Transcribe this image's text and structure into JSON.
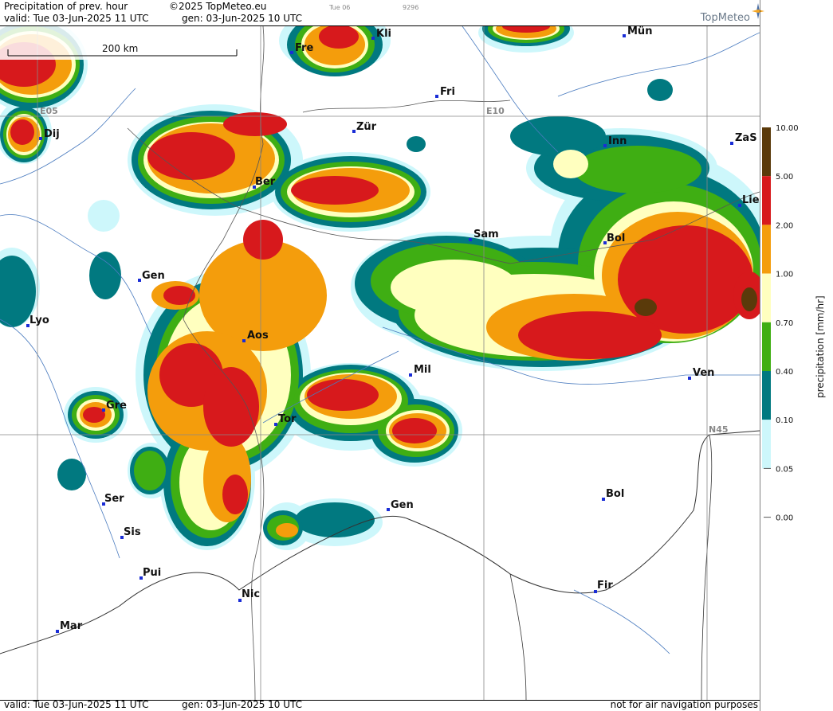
{
  "header": {
    "title": "Precipitation of prev. hour",
    "copyright": "©2025 TopMeteo.eu",
    "small_date": "Tue 06",
    "small_code": "9296",
    "valid": "valid:  Tue  03-Jun-2025  11 UTC",
    "gen": "gen:  03-Jun-2025 10 UTC",
    "logo": "TopMeteo"
  },
  "footer": {
    "valid": "valid:  Tue  03-Jun-2025  11 UTC",
    "gen": "gen: 03-Jun-2025 10 UTC",
    "disclaimer": "not for air navigation purposes"
  },
  "map": {
    "scale_label": "200 km",
    "grid_labels": [
      "E05",
      "E10",
      "N45"
    ],
    "cities": [
      {
        "name": "Kli"
      },
      {
        "name": "Mün"
      },
      {
        "name": "Fre"
      },
      {
        "name": "Fri"
      },
      {
        "name": "Dij"
      },
      {
        "name": "Zür"
      },
      {
        "name": "Inn"
      },
      {
        "name": "ZaS"
      },
      {
        "name": "Ber"
      },
      {
        "name": "Lie"
      },
      {
        "name": "Sam"
      },
      {
        "name": "Bol"
      },
      {
        "name": "Gen"
      },
      {
        "name": "Lyo"
      },
      {
        "name": "Aos"
      },
      {
        "name": "Mil"
      },
      {
        "name": "Ven"
      },
      {
        "name": "Gre"
      },
      {
        "name": "Tor"
      },
      {
        "name": "Ser"
      },
      {
        "name": "Gen"
      },
      {
        "name": "Bol"
      },
      {
        "name": "Sis"
      },
      {
        "name": "Pui"
      },
      {
        "name": "Nic"
      },
      {
        "name": "Fir"
      },
      {
        "name": "Mar"
      }
    ]
  },
  "legend": {
    "title": "precipitation [mm/hr]",
    "levels": [
      {
        "label": "10.00",
        "color": "#5a3a0a"
      },
      {
        "label": "5.00",
        "color": "#d7191c"
      },
      {
        "label": "2.00",
        "color": "#f49d0c"
      },
      {
        "label": "1.00",
        "color": "#ffffbf"
      },
      {
        "label": "0.70",
        "color": "#3fae13"
      },
      {
        "label": "0.40",
        "color": "#017980"
      },
      {
        "label": "0.10",
        "color": "#cdf7fb"
      },
      {
        "label": "0.05",
        "color": ""
      },
      {
        "label": "0.00",
        "color": ""
      }
    ]
  }
}
